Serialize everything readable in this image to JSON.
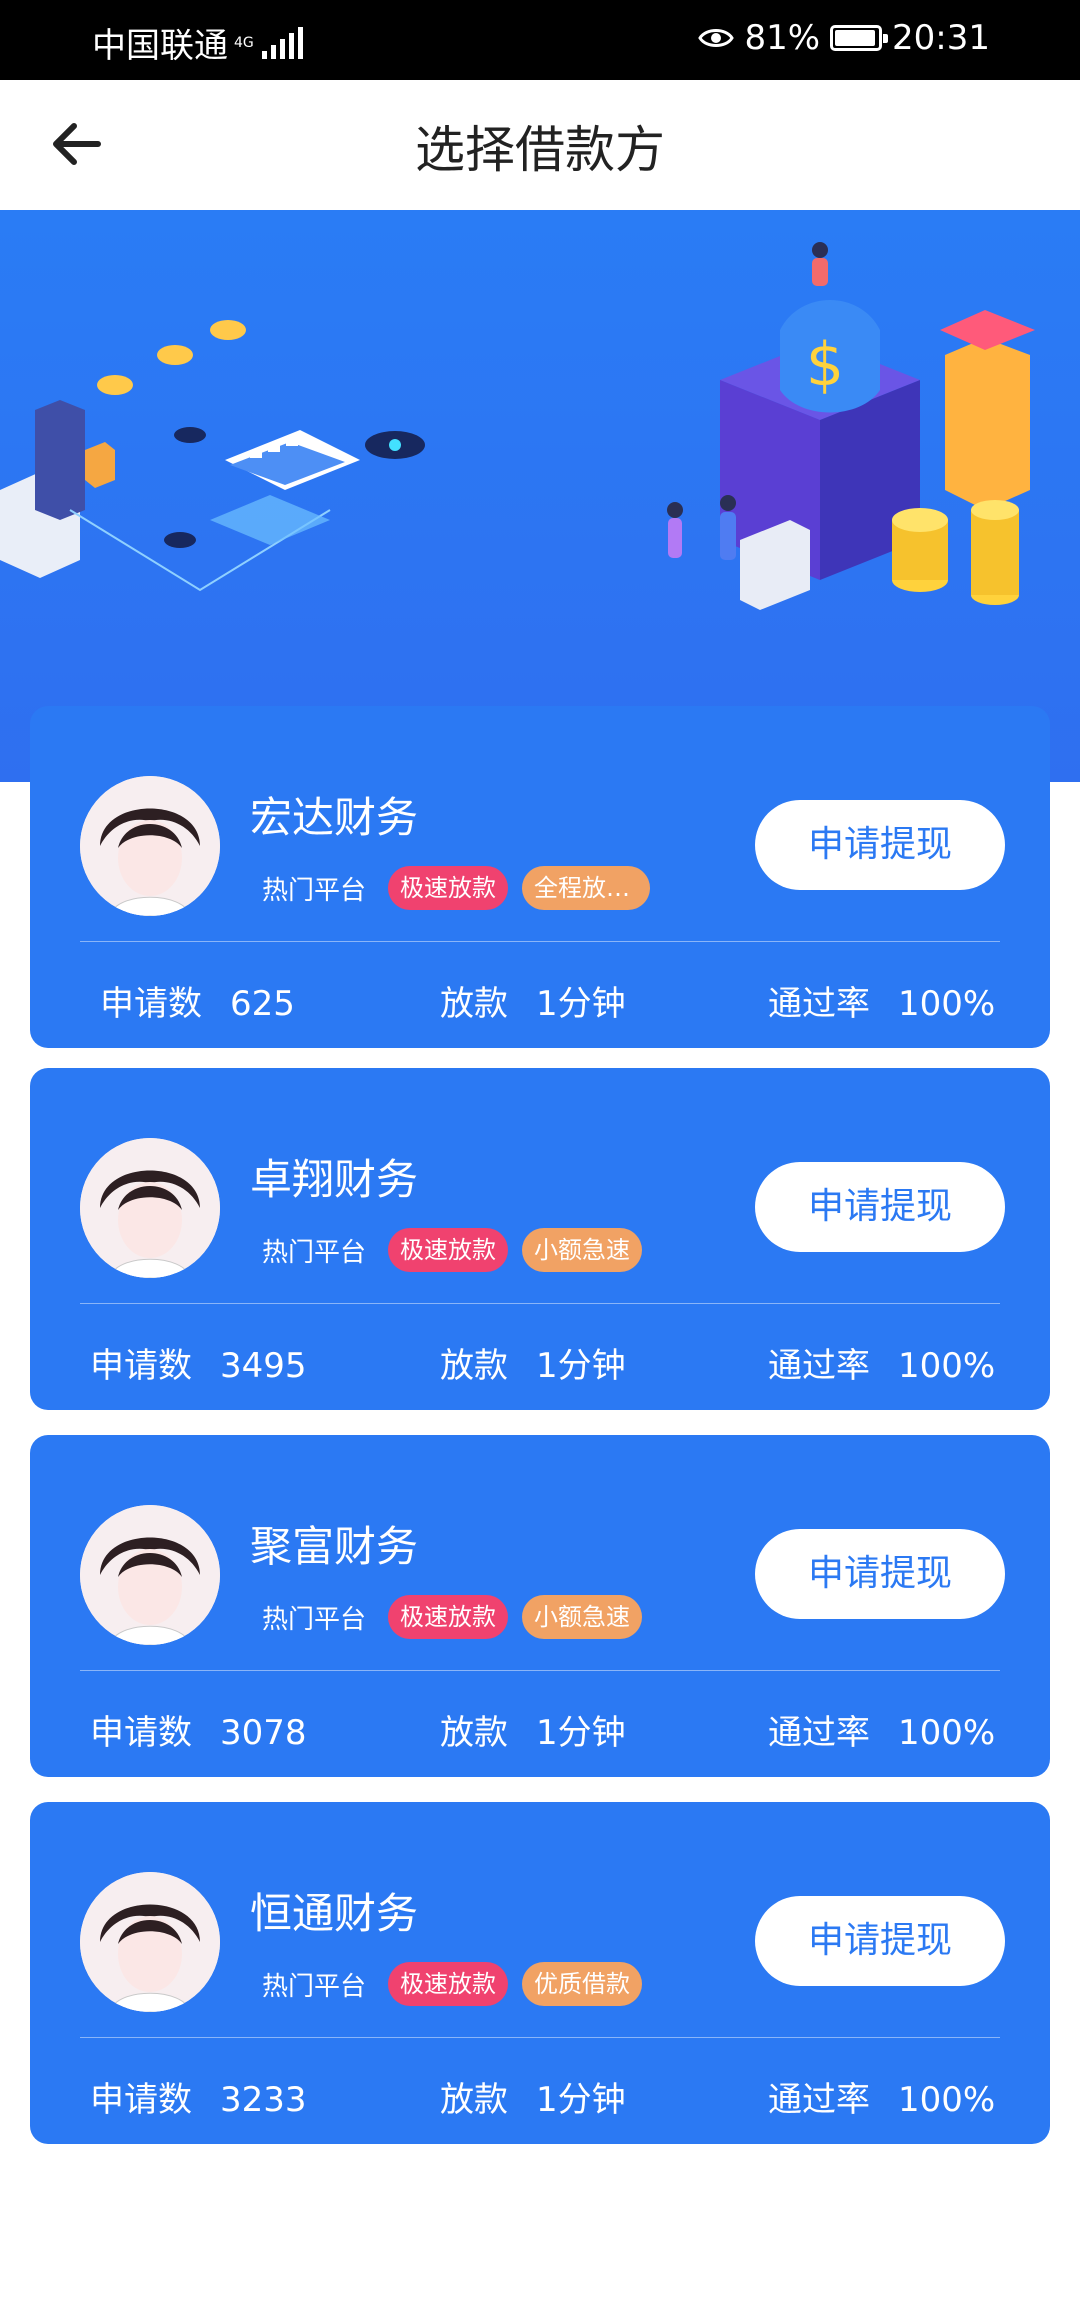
{
  "status_bar": {
    "carrier": "中国联通",
    "network": "4G",
    "battery_percent": "81%",
    "time": "20:31"
  },
  "header": {
    "title": "选择借款方"
  },
  "colors": {
    "primary": "#2b79f3",
    "tag_pink": "#f0426f",
    "tag_orange": "#f1a264"
  },
  "cards": [
    {
      "name": "宏达财务",
      "hot_label": "热门平台",
      "tag1": "极速放款",
      "tag2": "全程放款...",
      "button": "申请提现",
      "applications_label": "申请数",
      "applications": "625",
      "loan_label": "放款",
      "loan_time": "1分钟",
      "pass_rate_label": "通过率",
      "pass_rate": "100%"
    },
    {
      "name": "卓翔财务",
      "hot_label": "热门平台",
      "tag1": "极速放款",
      "tag2": "小额急速",
      "button": "申请提现",
      "applications_label": "申请数",
      "applications": "3495",
      "loan_label": "放款",
      "loan_time": "1分钟",
      "pass_rate_label": "通过率",
      "pass_rate": "100%"
    },
    {
      "name": "聚富财务",
      "hot_label": "热门平台",
      "tag1": "极速放款",
      "tag2": "小额急速",
      "button": "申请提现",
      "applications_label": "申请数",
      "applications": "3078",
      "loan_label": "放款",
      "loan_time": "1分钟",
      "pass_rate_label": "通过率",
      "pass_rate": "100%"
    },
    {
      "name": "恒通财务",
      "hot_label": "热门平台",
      "tag1": "极速放款",
      "tag2": "优质借款",
      "button": "申请提现",
      "applications_label": "申请数",
      "applications": "3233",
      "loan_label": "放款",
      "loan_time": "1分钟",
      "pass_rate_label": "通过率",
      "pass_rate": "100%"
    }
  ]
}
